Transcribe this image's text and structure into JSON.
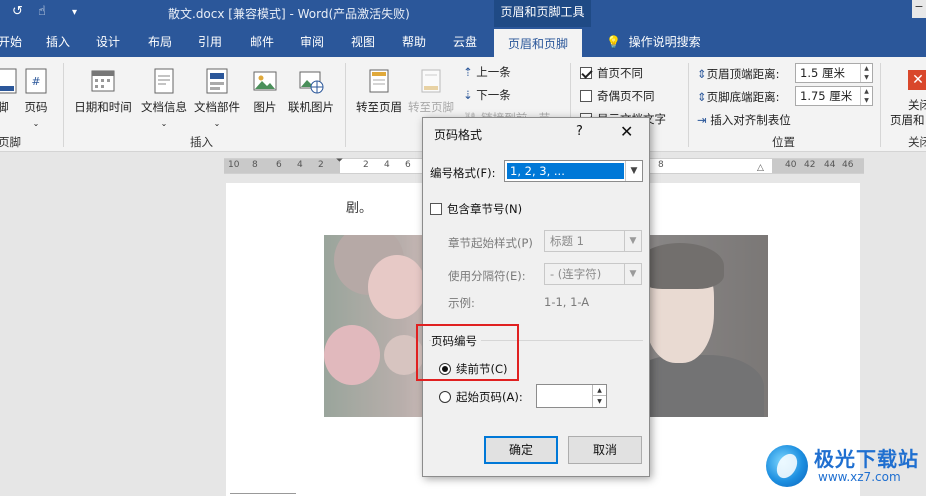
{
  "title_bar": {
    "doc_title": "散文.docx [兼容模式]  -  Word(产品激活失败)",
    "tool_context": "页眉和页脚工具",
    "win_button": "−"
  },
  "tabs": {
    "items": [
      "开始",
      "插入",
      "设计",
      "布局",
      "引用",
      "邮件",
      "审阅",
      "视图",
      "帮助",
      "云盘"
    ],
    "active": "页眉和页脚",
    "tell_me": "操作说明搜索"
  },
  "ribbon": {
    "footer_btn": "脚",
    "page_number": "页码",
    "date_time": "日期和时间",
    "doc_info": "文档信息",
    "doc_parts": "文档部件",
    "picture": "图片",
    "online_picture": "联机图片",
    "goto_header": "转至页眉",
    "goto_footer": "转至页脚",
    "prev": "上一条",
    "next": "下一条",
    "link_prev": "链接到前一节",
    "insert_group": "插入",
    "header_footer_group": "页脚",
    "different_first": "首页不同",
    "odd_even": "奇偶页不同",
    "show_doc_text": "显示文档文字",
    "header_top_label": "页眉顶端距离:",
    "header_top_value": "1.5 厘米",
    "footer_bottom_label": "页脚底端距离:",
    "footer_bottom_value": "1.75 厘米",
    "insert_align_tab": "插入对齐制表位",
    "position_group": "位置",
    "close_label_1": "关闭",
    "close_label_2": "页眉和",
    "close_group": "关闭"
  },
  "ruler": {
    "numbers": [
      "10",
      "8",
      "6",
      "4",
      "2",
      "2",
      "4",
      "6",
      "8",
      "40",
      "42",
      "44",
      "46",
      "48"
    ]
  },
  "document": {
    "text": "剧。"
  },
  "dialog": {
    "title": "页码格式",
    "help": "?",
    "close": "✕",
    "number_format_label": "编号格式(F):",
    "number_format_value": "1, 2, 3, ...",
    "include_chapter": "包含章节号(N)",
    "chapter_style_label": "章节起始样式(P)",
    "chapter_style_value": "标题 1",
    "separator_label": "使用分隔符(E):",
    "separator_value": "-  (连字符)",
    "example_label": "示例:",
    "example_value": "1-1, 1-A",
    "page_numbering_group": "页码编号",
    "continue_option": "续前节(C)",
    "start_at_option": "起始页码(A):",
    "start_at_value": "",
    "ok": "确定",
    "cancel": "取消"
  },
  "watermark": {
    "title": "极光下载站",
    "url": "www.xz7.com"
  },
  "colors": {
    "word_blue": "#2b579a",
    "highlight_red": "#e02020",
    "selection_blue": "#0078d7"
  }
}
